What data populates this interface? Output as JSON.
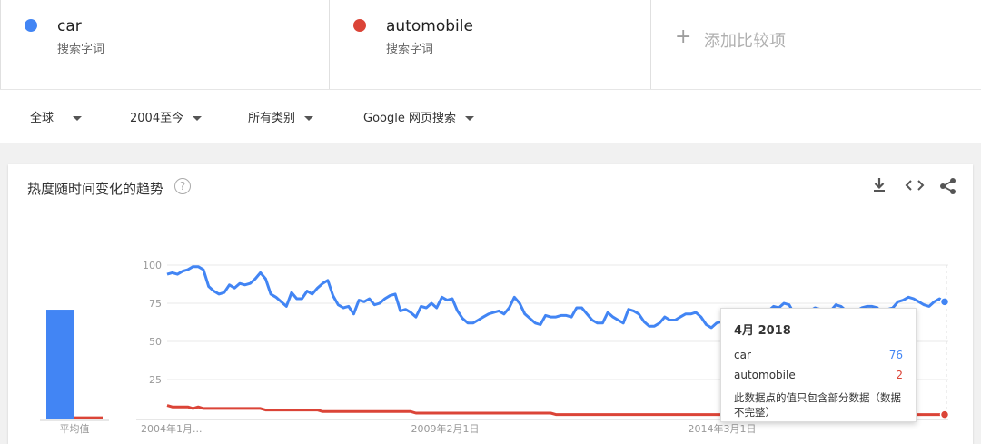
{
  "terms": [
    {
      "name": "car",
      "sub": "搜索字词",
      "color": "#4285f4"
    },
    {
      "name": "automobile",
      "sub": "搜索字词",
      "color": "#db4437"
    }
  ],
  "add_term": {
    "label": "添加比较项",
    "icon": "plus-icon"
  },
  "filters": {
    "region": "全球",
    "time": "2004至今",
    "category": "所有类别",
    "property": "Google 网页搜索"
  },
  "card": {
    "title": "热度随时间变化的趋势",
    "help_icon": "?",
    "tools": [
      "download-icon",
      "embed-icon",
      "share-icon"
    ]
  },
  "chart_data": {
    "type": "line",
    "y_ticks": [
      "100",
      "75",
      "50",
      "25"
    ],
    "ylim": [
      0,
      100
    ],
    "x_tick_labels": [
      "2004年1月...",
      "2009年2月1日",
      "2014年3月1日"
    ],
    "average_label": "平均值",
    "average": {
      "car": 72,
      "automobile": 2
    },
    "series": [
      {
        "name": "car",
        "color": "#4285f4",
        "values": [
          94,
          95,
          94,
          96,
          97,
          99,
          99,
          97,
          86,
          83,
          81,
          82,
          87,
          85,
          88,
          87,
          88,
          91,
          95,
          91,
          81,
          79,
          76,
          73,
          82,
          78,
          78,
          83,
          81,
          85,
          88,
          90,
          80,
          74,
          72,
          73,
          68,
          77,
          76,
          78,
          74,
          75,
          78,
          80,
          81,
          70,
          71,
          69,
          66,
          73,
          72,
          75,
          72,
          79,
          77,
          78,
          70,
          65,
          62,
          62,
          64,
          66,
          68,
          69,
          70,
          68,
          72,
          79,
          75,
          68,
          65,
          62,
          61,
          67,
          66,
          66,
          67,
          67,
          66,
          72,
          72,
          68,
          64,
          62,
          62,
          69,
          66,
          64,
          62,
          71,
          70,
          68,
          63,
          60,
          60,
          62,
          66,
          64,
          64,
          66,
          68,
          68,
          69,
          66,
          61,
          59,
          62,
          63,
          64,
          67,
          68,
          63,
          62,
          64,
          66,
          66,
          70,
          73,
          72,
          75,
          74,
          68,
          67,
          69,
          70,
          72,
          71,
          69,
          70,
          74,
          73,
          70,
          69,
          70,
          72,
          73,
          73,
          72,
          68,
          71,
          72,
          76,
          77,
          79,
          78,
          76,
          74,
          73,
          76,
          78,
          76
        ]
      },
      {
        "name": "automobile",
        "color": "#db4437",
        "values": [
          8,
          7,
          7,
          7,
          7,
          6,
          7,
          6,
          6,
          6,
          6,
          6,
          6,
          6,
          6,
          6,
          6,
          6,
          6,
          5,
          5,
          5,
          5,
          5,
          5,
          5,
          5,
          5,
          5,
          5,
          4,
          4,
          4,
          4,
          4,
          4,
          4,
          4,
          4,
          4,
          4,
          4,
          4,
          4,
          4,
          4,
          4,
          4,
          3,
          3,
          3,
          3,
          3,
          3,
          3,
          3,
          3,
          3,
          3,
          3,
          3,
          3,
          3,
          3,
          3,
          3,
          3,
          3,
          3,
          3,
          3,
          3,
          3,
          3,
          3,
          2,
          2,
          2,
          2,
          2,
          2,
          2,
          2,
          2,
          2,
          2,
          2,
          2,
          2,
          2,
          2,
          2,
          2,
          2,
          2,
          2,
          2,
          2,
          2,
          2,
          2,
          2,
          2,
          2,
          2,
          2,
          2,
          2,
          2,
          2,
          2,
          2,
          2,
          2,
          2,
          2,
          2,
          2,
          2,
          2,
          2,
          2,
          2,
          2,
          2,
          2,
          2,
          2,
          2,
          2,
          2,
          2,
          2,
          2,
          2,
          2,
          2,
          2,
          2,
          2,
          2,
          2,
          2,
          2,
          2,
          2,
          2,
          2,
          2,
          2,
          2
        ]
      }
    ],
    "grid": true
  },
  "tooltip": {
    "date": "4月 2018",
    "rows": [
      {
        "name": "car",
        "value": "76",
        "color": "#4285f4"
      },
      {
        "name": "automobile",
        "value": "2",
        "color": "#db4437"
      }
    ],
    "note": "此数据点的值只包含部分数据（数据不完整）"
  }
}
